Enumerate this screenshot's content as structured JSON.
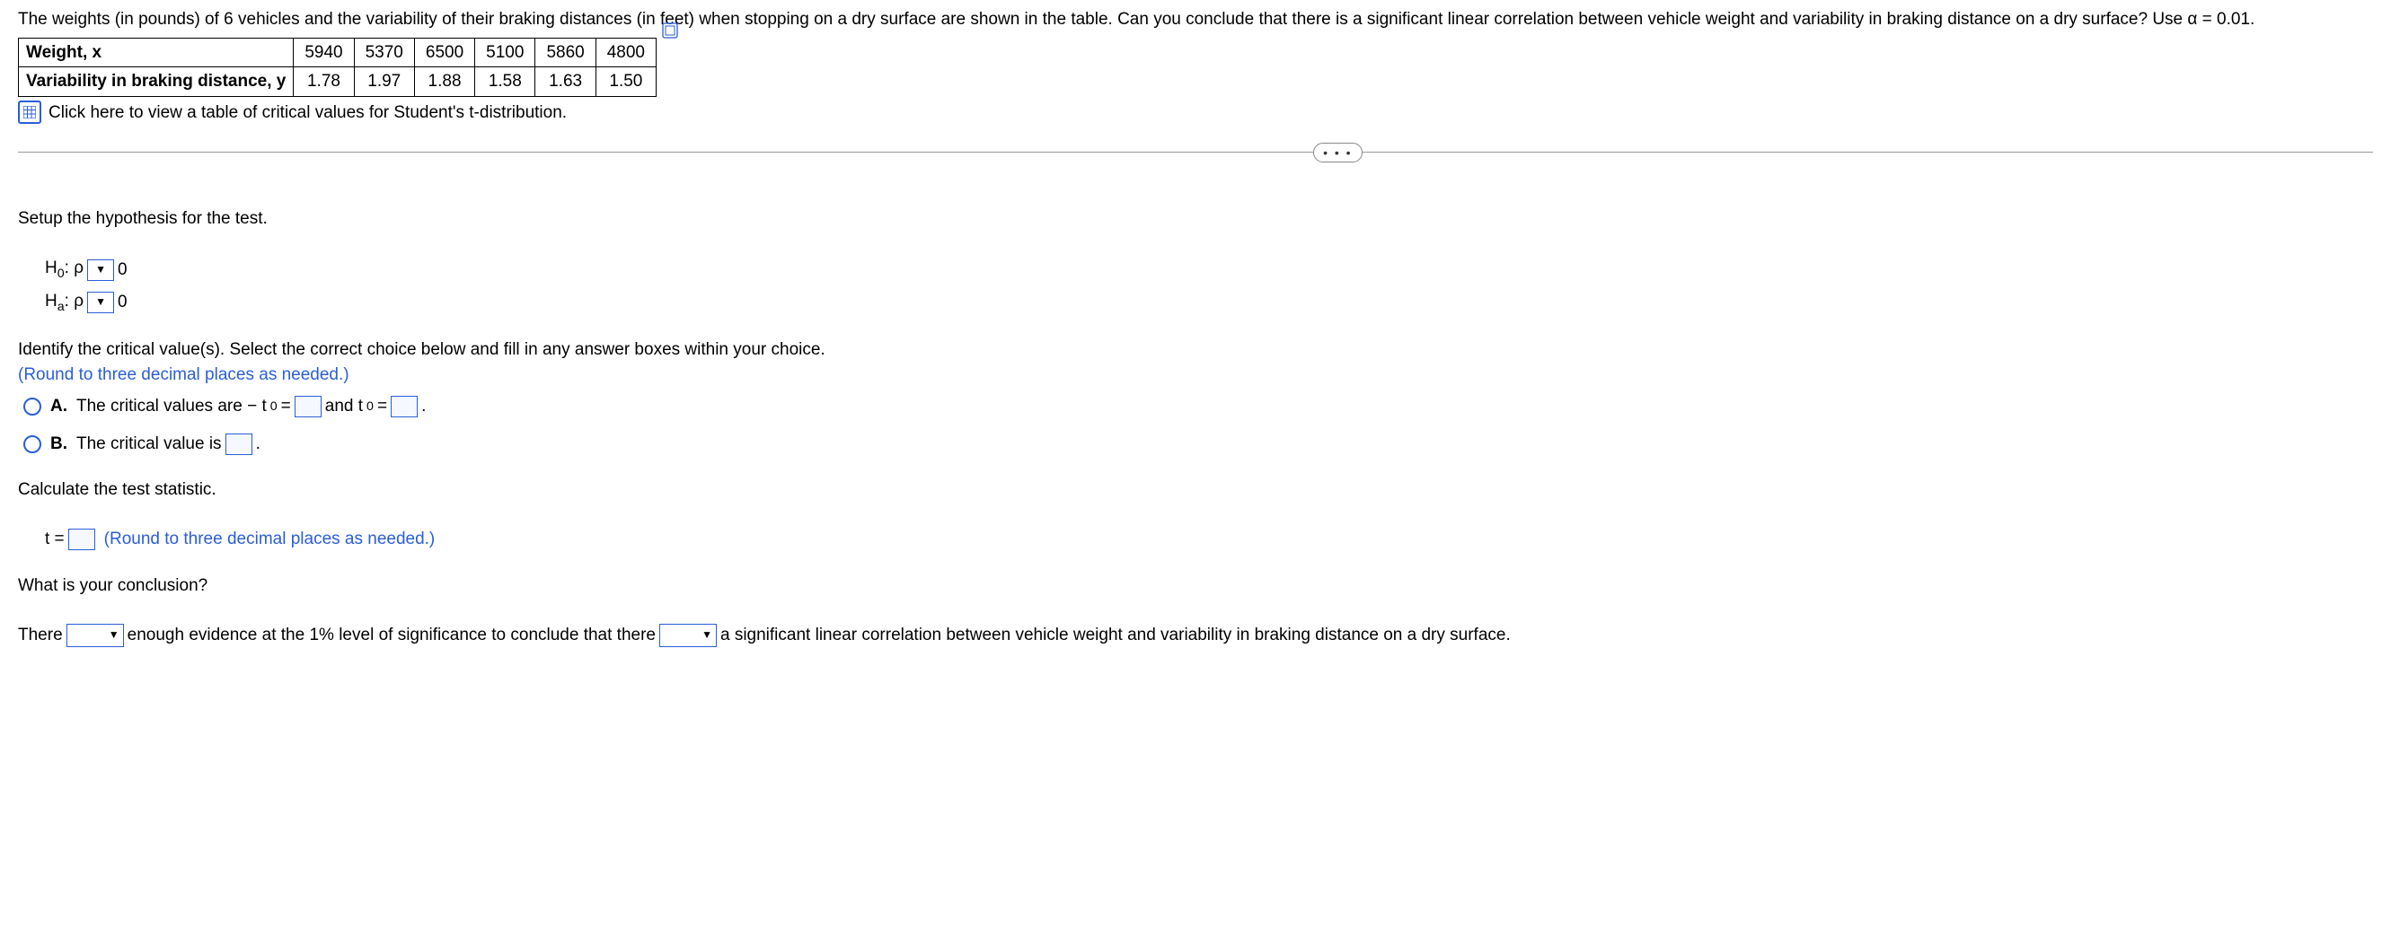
{
  "problem": {
    "line1": "The weights (in pounds) of 6 vehicles and the variability of their braking distances (in feet) when stopping on a dry surface are shown in the table. Can you conclude that there is a significant linear correlation between vehicle weight and variability in braking distance on a dry surface? Use α = 0.01."
  },
  "table": {
    "row1_label": "Weight, x",
    "row1": [
      "5940",
      "5370",
      "6500",
      "5100",
      "5860",
      "4800"
    ],
    "row2_label": "Variability in braking distance, y",
    "row2": [
      "1.78",
      "1.97",
      "1.88",
      "1.58",
      "1.63",
      "1.50"
    ]
  },
  "link_text": "Click here to view a table of critical values for Student's t-distribution.",
  "ellipsis": "• • •",
  "q1": {
    "prompt": "Setup the hypothesis for the test.",
    "h0_prefix": "H",
    "h0_sub": "0",
    "rho": ": ρ",
    "zero": "0",
    "ha_sub": "a"
  },
  "q2": {
    "prompt": "Identify the critical value(s). Select the correct choice below and fill in any answer boxes within your choice.",
    "round_note": "(Round to three decimal places as needed.)",
    "optA_label": "A.",
    "optA_text1": "The critical values are  − t",
    "optA_sub": "0",
    "optA_eq": " = ",
    "optA_text2": " and t",
    "optA_end": " .",
    "optB_label": "B.",
    "optB_text": "The critical value is ",
    "optB_end": " ."
  },
  "q3": {
    "prompt": "Calculate the test statistic.",
    "t_eq": "t = ",
    "round_note": "(Round to three decimal places as needed.)"
  },
  "q4": {
    "prompt": "What is your conclusion?",
    "part1": "There ",
    "part2": " enough evidence at the 1% level of significance to conclude that there ",
    "part3": " a significant linear correlation between vehicle weight and variability in braking distance on a dry surface."
  }
}
